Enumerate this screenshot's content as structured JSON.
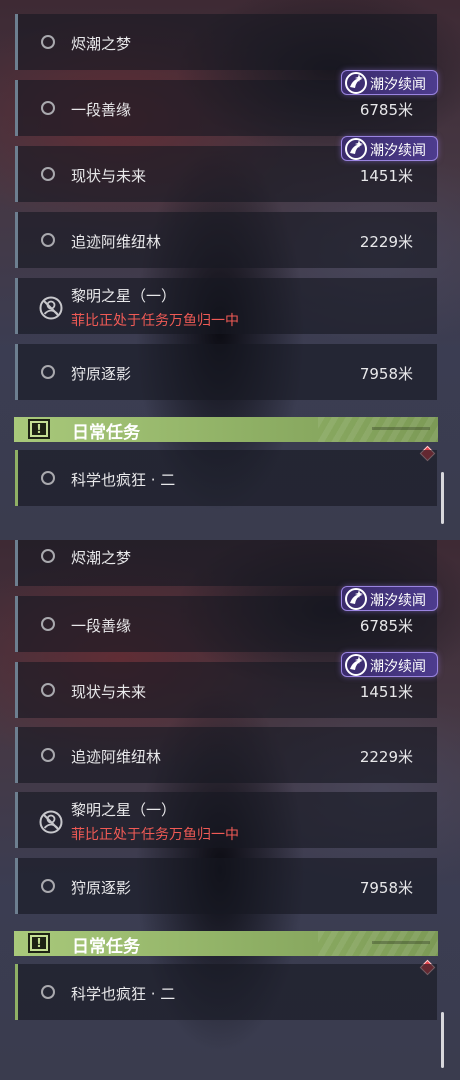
{
  "quests": [
    {
      "name": "烬潮之梦"
    },
    {
      "name": "一段善缘",
      "distance": "6785米",
      "badge": "潮汐续闻"
    },
    {
      "name": "现状与未来",
      "distance": "1451米",
      "badge": "潮汐续闻"
    },
    {
      "name": "追迹阿维纽林",
      "distance": "2229米"
    },
    {
      "name": "黎明之星（一）",
      "note": "菲比正处于任务万鱼归一中",
      "locked": true
    },
    {
      "name": "狩原逐影",
      "distance": "7958米"
    }
  ],
  "daily_section": {
    "title": "日常任务",
    "icon": "alert-icon"
  },
  "daily_quests": [
    {
      "name": "科学也疯狂 · 二"
    }
  ],
  "colors": {
    "accent_green": "#a9c97b",
    "badge_purple": "#4d3c8e",
    "warning_red": "#ef5a55"
  }
}
